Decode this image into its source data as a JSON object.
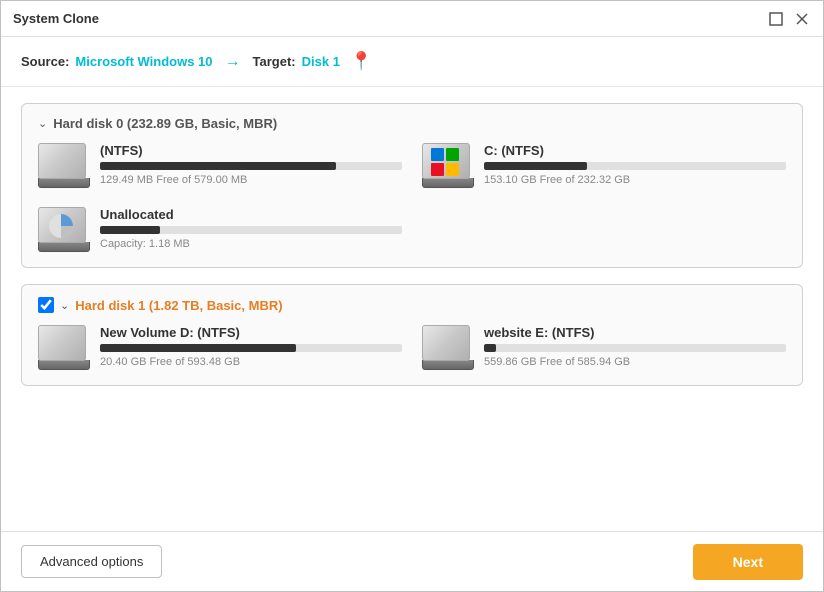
{
  "window": {
    "title": "System Clone"
  },
  "header": {
    "source_label": "Source:",
    "source_value": "Microsoft Windows 10",
    "target_label": "Target:",
    "target_value": "Disk 1"
  },
  "disks": [
    {
      "id": "disk0",
      "title": "Hard disk 0 (232.89 GB, Basic, MBR)",
      "checked": false,
      "color": "gray",
      "partitions": [
        {
          "name": "(NTFS)",
          "has_windows_icon": false,
          "has_pie_icon": false,
          "fill_percent": 78,
          "free_text": "129.49 MB Free of 579.00 MB"
        },
        {
          "name": "C: (NTFS)",
          "has_windows_icon": true,
          "has_pie_icon": false,
          "fill_percent": 34,
          "free_text": "153.10 GB Free of 232.32 GB"
        },
        {
          "name": "Unallocated",
          "has_windows_icon": false,
          "has_pie_icon": true,
          "fill_percent": 20,
          "free_text": "Capacity: 1.18 MB",
          "span_full": true
        }
      ]
    },
    {
      "id": "disk1",
      "title": "Hard disk 1 (1.82 TB, Basic, MBR)",
      "checked": true,
      "color": "orange",
      "partitions": [
        {
          "name": "New Volume D: (NTFS)",
          "has_windows_icon": false,
          "has_pie_icon": false,
          "fill_percent": 65,
          "free_text": "20.40 GB Free of 593.48 GB"
        },
        {
          "name": "website E: (NTFS)",
          "has_windows_icon": false,
          "has_pie_icon": false,
          "fill_percent": 4,
          "free_text": "559.86 GB Free of 585.94 GB"
        }
      ]
    }
  ],
  "footer": {
    "advanced_label": "Advanced options",
    "next_label": "Next"
  }
}
